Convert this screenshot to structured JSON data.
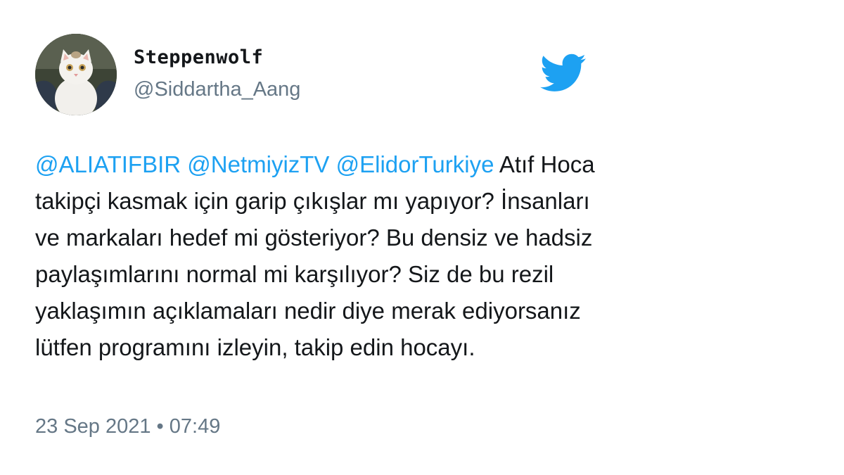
{
  "author": {
    "display_name": "Steppenwolf",
    "handle": "@Siddartha_Aang"
  },
  "tweet": {
    "mentions": [
      "@ALIATIFBIR",
      "@NetmiyizTV",
      "@ElidorTurkiye"
    ],
    "body": "Atıf Hoca takipçi kasmak için garip çıkışlar mı yapıyor? İnsanları ve markaları hedef mi gösteriyor? Bu densiz ve hadsiz paylaşımlarını normal mi karşılıyor? Siz de bu rezil yaklaşımın açıklamaları nedir diye merak ediyorsanız lütfen programını izleyin, takip edin hocayı.",
    "timestamp": "23 Sep 2021 • 07:49"
  },
  "icons": {
    "brand": "twitter-bird-icon",
    "avatar": "cat-avatar"
  },
  "colors": {
    "brand_blue": "#1da1f2",
    "text": "#14171a",
    "muted": "#657786",
    "background": "#ffffff"
  }
}
